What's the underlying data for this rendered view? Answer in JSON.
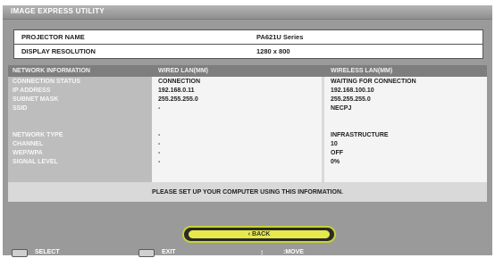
{
  "window": {
    "title": "IMAGE EXPRESS UTILITY"
  },
  "projector_info": [
    {
      "label": "PROJECTOR NAME",
      "value": "PA621U Series"
    },
    {
      "label": "DISPLAY RESOLUTION",
      "value": "1280 x 800"
    }
  ],
  "network": {
    "headers": {
      "label": "NETWORK INFORMATION",
      "wired": "WIRED LAN(MM)",
      "wireless": "WIRELESS LAN(MM)"
    },
    "rows": [
      {
        "label": "CONNECTION STATUS",
        "wired": "CONNECTION",
        "wireless": "WAITING FOR CONNECTION"
      },
      {
        "label": "IP ADDRESS",
        "wired": "192.168.0.11",
        "wireless": "192.168.100.10"
      },
      {
        "label": "SUBNET MASK",
        "wired": "255.255.255.0",
        "wireless": "255.255.255.0"
      },
      {
        "label": "SSID",
        "wired": "-",
        "wireless": "NECPJ"
      },
      {
        "label": "NETWORK TYPE",
        "wired": "-",
        "wireless": "INFRASTRUCTURE"
      },
      {
        "label": "CHANNEL",
        "wired": "-",
        "wireless": "10"
      },
      {
        "label": "WEP/WPA",
        "wired": "-",
        "wireless": "OFF"
      },
      {
        "label": "SIGNAL LEVEL",
        "wired": "-",
        "wireless": "0%"
      }
    ],
    "message": "PLEASE SET UP YOUR COMPUTER USING THIS INFORMATION."
  },
  "back_button": {
    "label": "BACK"
  },
  "footer": {
    "select_label": "SELECT",
    "exit_label": "EXIT",
    "move_label": ":MOVE",
    "move_arrows": "↕"
  }
}
